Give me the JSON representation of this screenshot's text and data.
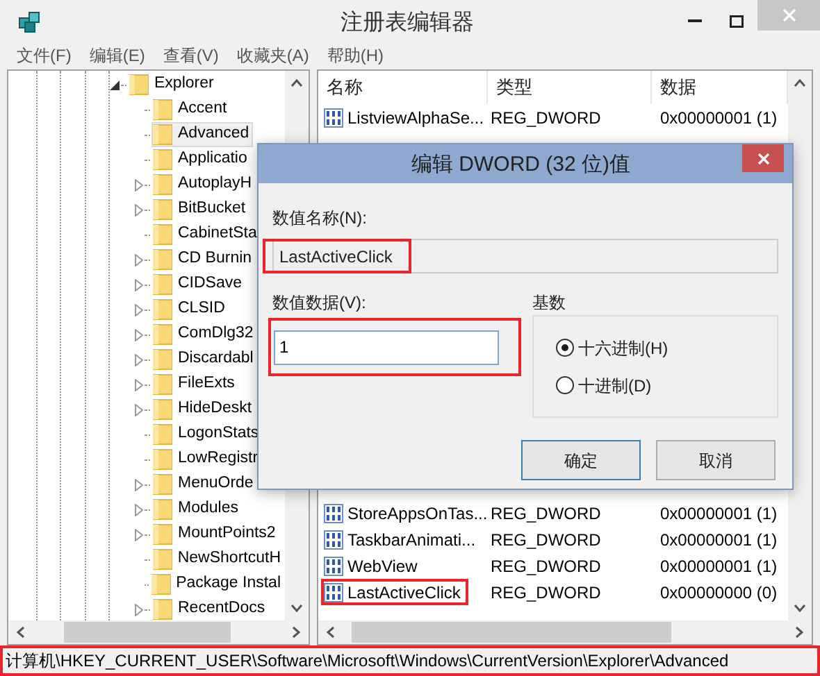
{
  "window": {
    "title": "注册表编辑器"
  },
  "menu": [
    "文件(F)",
    "编辑(E)",
    "查看(V)",
    "收藏夹(A)",
    "帮助(H)"
  ],
  "tree": {
    "items": [
      {
        "label": "Explorer",
        "expanded": true,
        "selected": false,
        "children": [
          {
            "label": "Accent",
            "has_children": false,
            "selected": false
          },
          {
            "label": "Advanced",
            "has_children": false,
            "selected": true
          },
          {
            "label": "Applicatio",
            "has_children": false,
            "selected": false
          },
          {
            "label": "AutoplayH",
            "has_children": true,
            "selected": false
          },
          {
            "label": "BitBucket",
            "has_children": true,
            "selected": false
          },
          {
            "label": "CabinetSta",
            "has_children": false,
            "selected": false
          },
          {
            "label": "CD Burnin",
            "has_children": true,
            "selected": false
          },
          {
            "label": "CIDSave",
            "has_children": true,
            "selected": false
          },
          {
            "label": "CLSID",
            "has_children": true,
            "selected": false
          },
          {
            "label": "ComDlg32",
            "has_children": true,
            "selected": false
          },
          {
            "label": "Discardabl",
            "has_children": true,
            "selected": false
          },
          {
            "label": "FileExts",
            "has_children": true,
            "selected": false
          },
          {
            "label": "HideDeskt",
            "has_children": true,
            "selected": false
          },
          {
            "label": "LogonStats",
            "has_children": false,
            "selected": false
          },
          {
            "label": "LowRegistr",
            "has_children": false,
            "selected": false
          },
          {
            "label": "MenuOrde",
            "has_children": true,
            "selected": false
          },
          {
            "label": "Modules",
            "has_children": true,
            "selected": false
          },
          {
            "label": "MountPoints2",
            "has_children": true,
            "selected": false
          },
          {
            "label": "NewShortcutH",
            "has_children": false,
            "selected": false
          },
          {
            "label": "Package Instal",
            "has_children": false,
            "selected": false
          },
          {
            "label": "RecentDocs",
            "has_children": true,
            "selected": false
          }
        ]
      }
    ]
  },
  "list": {
    "columns": [
      "名称",
      "类型",
      "数据"
    ],
    "rows": [
      {
        "name": "ListviewAlphaSe...",
        "type": "REG_DWORD",
        "data": "0x00000001 (1)",
        "highlighted": false
      },
      {
        "name": "StoreAppsOnTas...",
        "type": "REG_DWORD",
        "data": "0x00000001 (1)",
        "highlighted": false
      },
      {
        "name": "TaskbarAnimati...",
        "type": "REG_DWORD",
        "data": "0x00000001 (1)",
        "highlighted": false
      },
      {
        "name": "WebView",
        "type": "REG_DWORD",
        "data": "0x00000001 (1)",
        "highlighted": false
      },
      {
        "name": "LastActiveClick",
        "type": "REG_DWORD",
        "data": "0x00000000 (0)",
        "highlighted": true
      }
    ]
  },
  "dialog": {
    "title": "编辑 DWORD (32 位)值",
    "name_label": "数值名称(N):",
    "name_value": "LastActiveClick",
    "name_highlighted": true,
    "data_label": "数值数据(V):",
    "data_value": "1",
    "data_highlighted": true,
    "base_label": "基数",
    "base_options": [
      {
        "label": "十六进制(H)",
        "selected": true
      },
      {
        "label": "十进制(D)",
        "selected": false
      }
    ],
    "buttons": [
      {
        "label": "确定",
        "default": true
      },
      {
        "label": "取消",
        "default": false
      }
    ]
  },
  "status_bar": {
    "path": "计算机\\HKEY_CURRENT_USER\\Software\\Microsoft\\Windows\\CurrentVersion\\Explorer\\Advanced",
    "highlighted": true
  }
}
